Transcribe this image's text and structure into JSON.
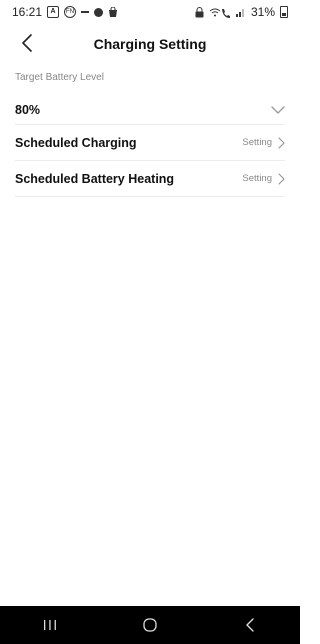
{
  "status_bar": {
    "time": "16:21",
    "battery_percent": "31%",
    "left_icons": [
      "a-box-icon",
      "fn-circle-icon",
      "dash-icon",
      "chrome-icon",
      "bag-icon"
    ],
    "right_icons": [
      "lock-icon",
      "wifi-call-icon",
      "signal-icon",
      "battery-icon"
    ]
  },
  "header": {
    "back_icon": "chevron-left-icon",
    "title": "Charging Setting"
  },
  "settings": {
    "target_battery_label": "Target Battery Level",
    "target_battery_value": "80%",
    "rows": [
      {
        "title": "Scheduled Charging",
        "action": "Setting"
      },
      {
        "title": "Scheduled Battery Heating",
        "action": "Setting"
      }
    ]
  },
  "nav_bar": {
    "buttons": [
      "recent-apps-icon",
      "home-icon",
      "back-nav-icon"
    ]
  },
  "colors": {
    "text_primary": "#111111",
    "text_secondary": "#888888",
    "divider": "#ececec",
    "nav_bar_bg": "#000000"
  }
}
